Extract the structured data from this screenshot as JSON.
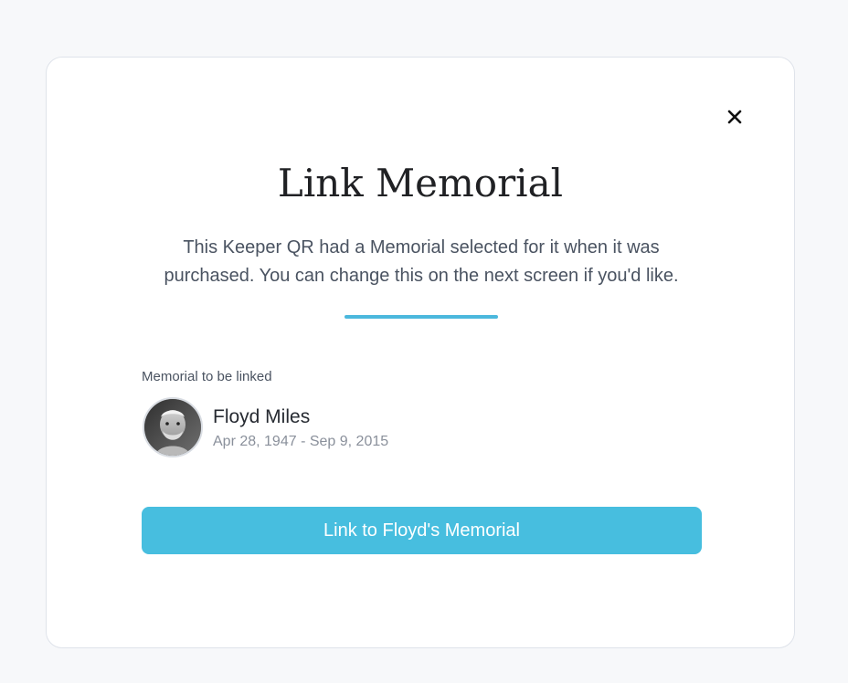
{
  "modal": {
    "title": "Link Memorial",
    "description": "This Keeper QR had a Memorial selected for it when it was purchased. You can change this on the next screen if you'd like.",
    "close_icon": "close-icon",
    "section_label": "Memorial to be linked",
    "memorial": {
      "name": "Floyd Miles",
      "dates": "Apr 28, 1947 - Sep 9, 2015",
      "avatar_icon": "memorial-portrait-avatar"
    },
    "primary_button_label": "Link to Floyd's Memorial"
  },
  "colors": {
    "page_background": "#f7f8fa",
    "card_background": "#ffffff",
    "accent": "#47bedf",
    "divider": "#4bb8dd",
    "title_text": "#202124",
    "body_text": "#4a5361",
    "muted_text": "#8a909b"
  }
}
